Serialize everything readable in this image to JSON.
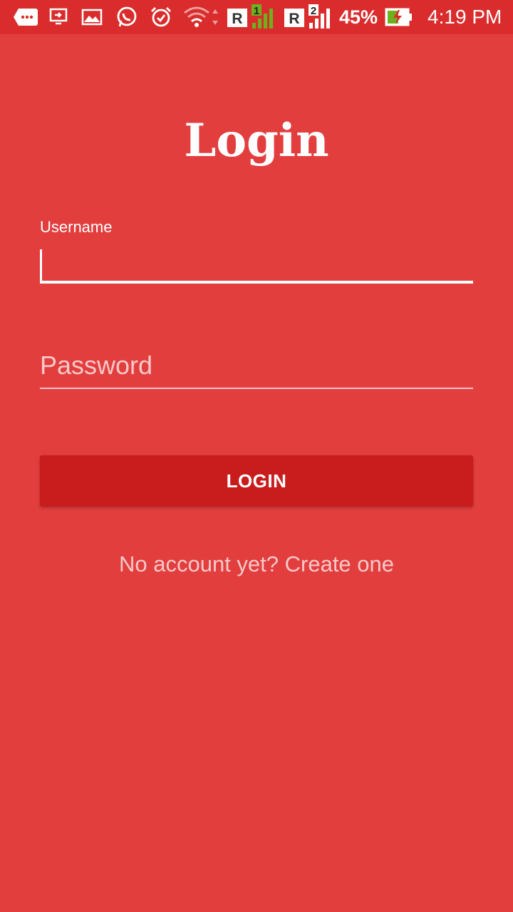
{
  "status_bar": {
    "icons": [
      "chat-bubble-icon",
      "cast-icon",
      "gallery-icon",
      "whatsapp-icon",
      "alarm-icon",
      "wifi-icon",
      "sim1-signal-icon",
      "sim2-signal-icon",
      "battery-charging-icon"
    ],
    "sim1_label": "1",
    "sim2_label": "2",
    "roaming_label": "R",
    "battery_percent": "45%",
    "time": "4:19 PM"
  },
  "login": {
    "title": "Login",
    "username_label": "Username",
    "username_value": "",
    "password_placeholder": "Password",
    "button_label": "LOGIN",
    "signup_link": "No account yet? Create one"
  },
  "colors": {
    "background": "#E33E3E",
    "status_bar": "#DA2C2C",
    "button": "#C91C1C"
  }
}
